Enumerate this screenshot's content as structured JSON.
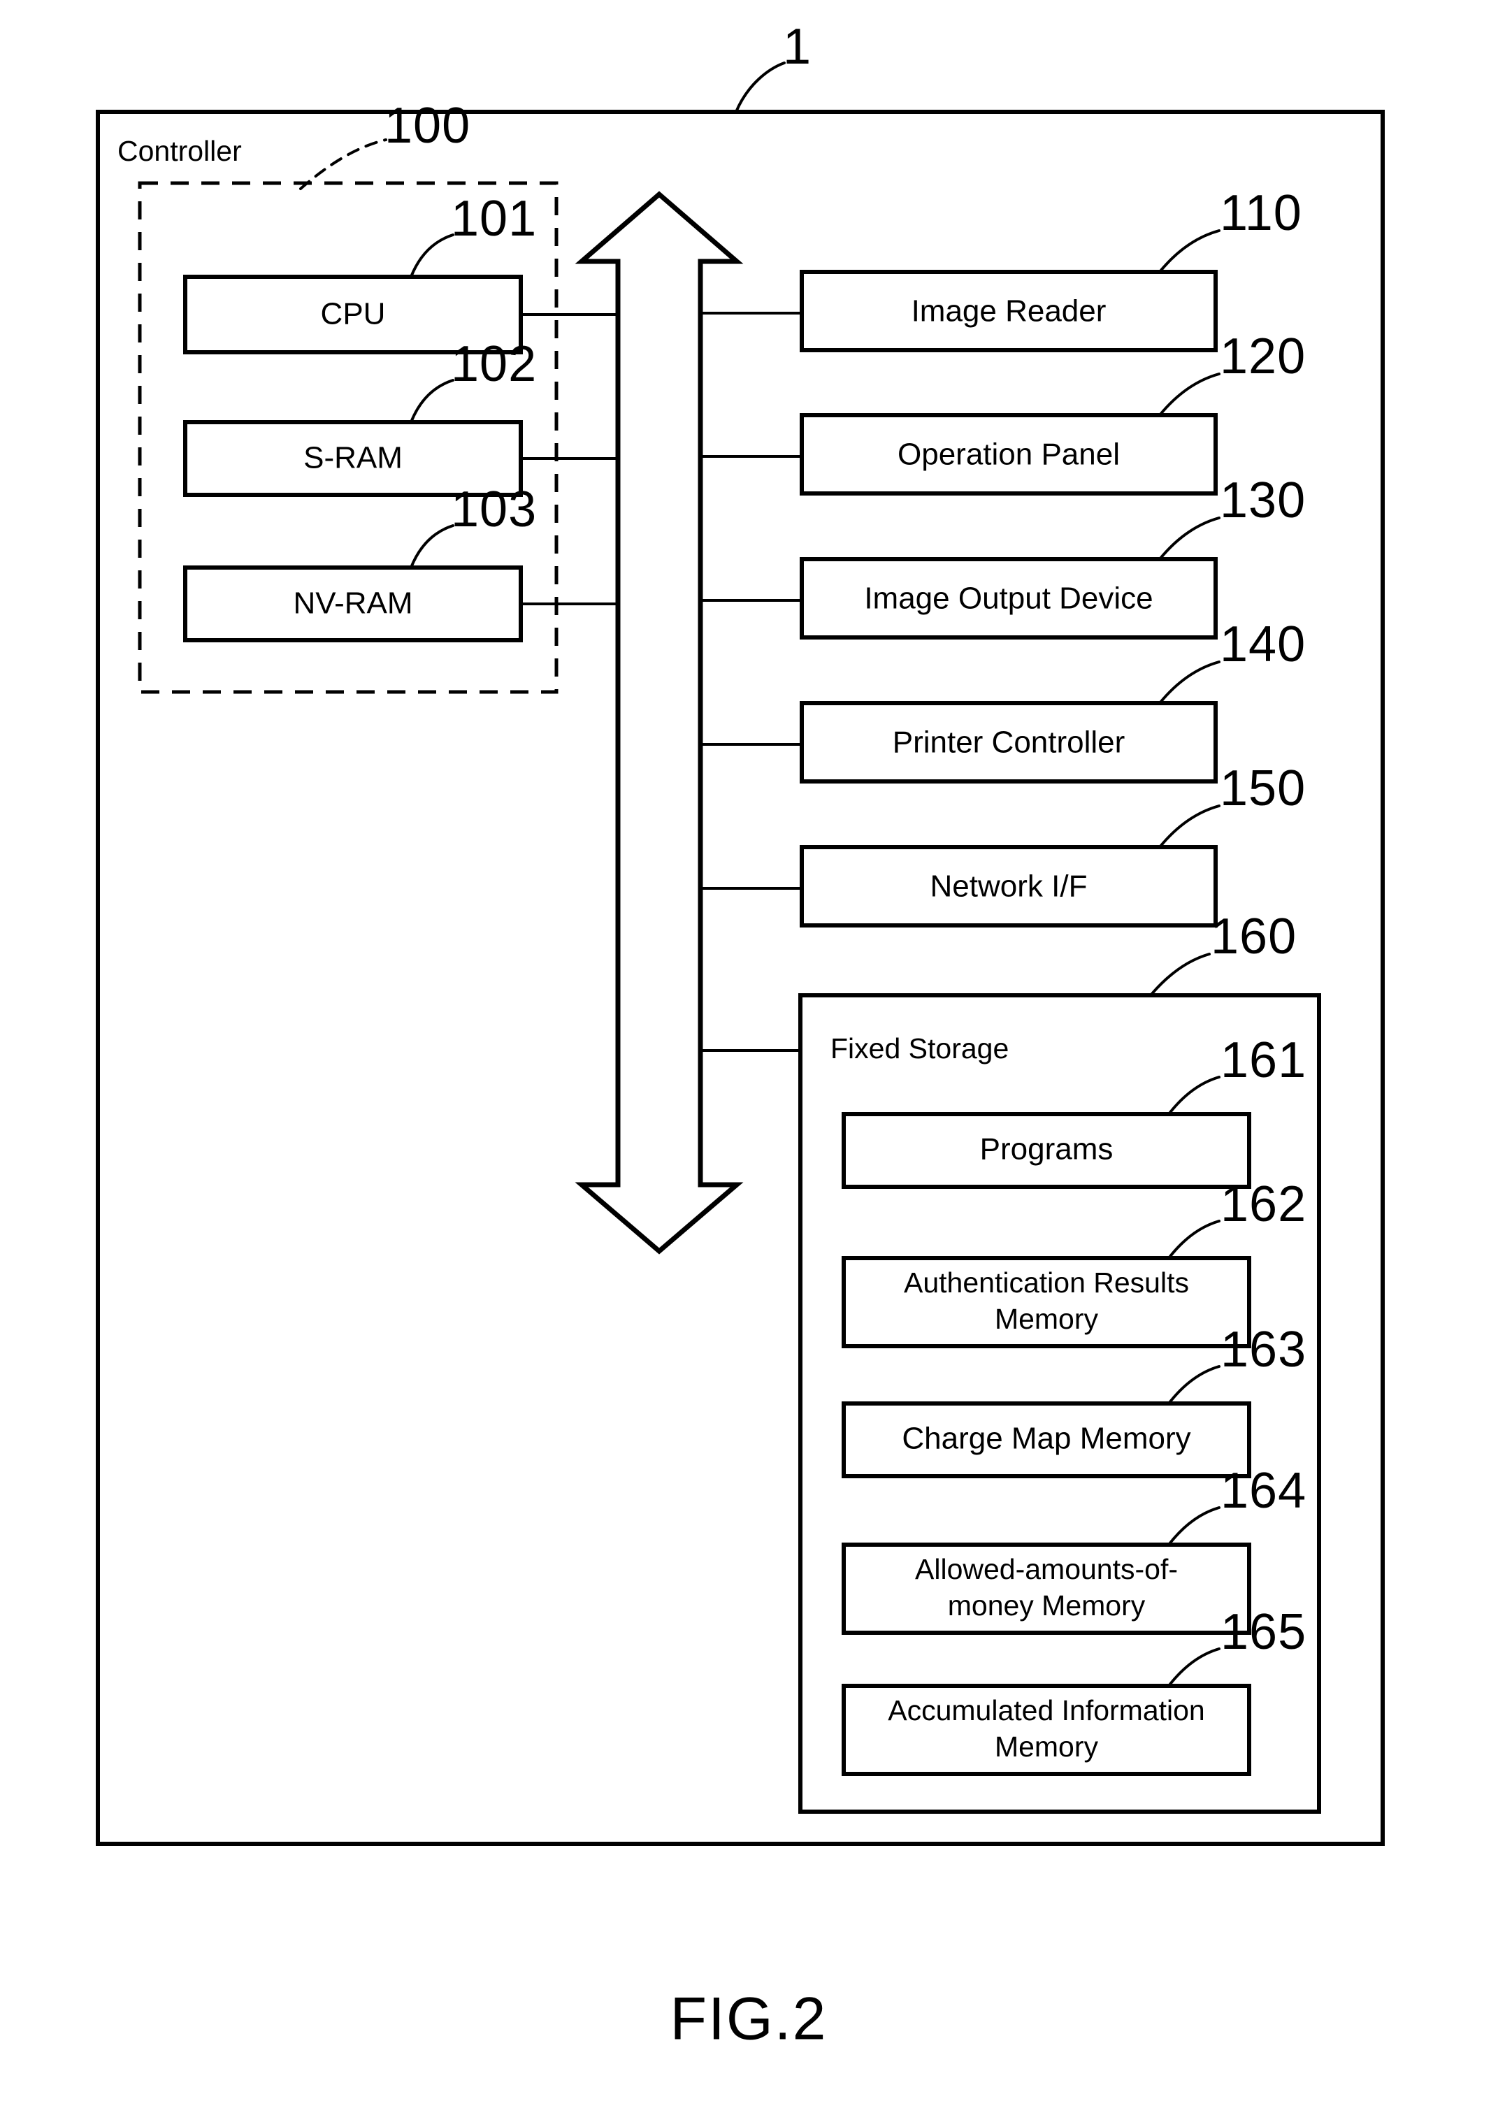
{
  "figure": {
    "caption": "FIG.2",
    "device_ref": "1",
    "controller_label": "Controller",
    "controller_ref": "100",
    "fixed_storage_label": "Fixed Storage",
    "fixed_storage_ref": "160"
  },
  "controller_blocks": [
    {
      "label": "CPU",
      "ref": "101"
    },
    {
      "label": "S-RAM",
      "ref": "102"
    },
    {
      "label": "NV-RAM",
      "ref": "103"
    }
  ],
  "peripheral_blocks": [
    {
      "label": "Image Reader",
      "ref": "110"
    },
    {
      "label": "Operation Panel",
      "ref": "120"
    },
    {
      "label": "Image Output Device",
      "ref": "130"
    },
    {
      "label": "Printer Controller",
      "ref": "140"
    },
    {
      "label": "Network I/F",
      "ref": "150"
    }
  ],
  "storage_blocks": [
    {
      "line1": "Programs",
      "line2": "",
      "ref": "161"
    },
    {
      "line1": "Authentication Results",
      "line2": "Memory",
      "ref": "162"
    },
    {
      "line1": "Charge Map Memory",
      "line2": "",
      "ref": "163"
    },
    {
      "line1": "Allowed-amounts-of-",
      "line2": "money Memory",
      "ref": "164"
    },
    {
      "line1": "Accumulated Information",
      "line2": "Memory",
      "ref": "165"
    }
  ],
  "bus": {
    "name": "system-bus",
    "direction": "bidirectional-vertical"
  },
  "colors": {
    "ink": "#000000",
    "paper": "#ffffff"
  }
}
